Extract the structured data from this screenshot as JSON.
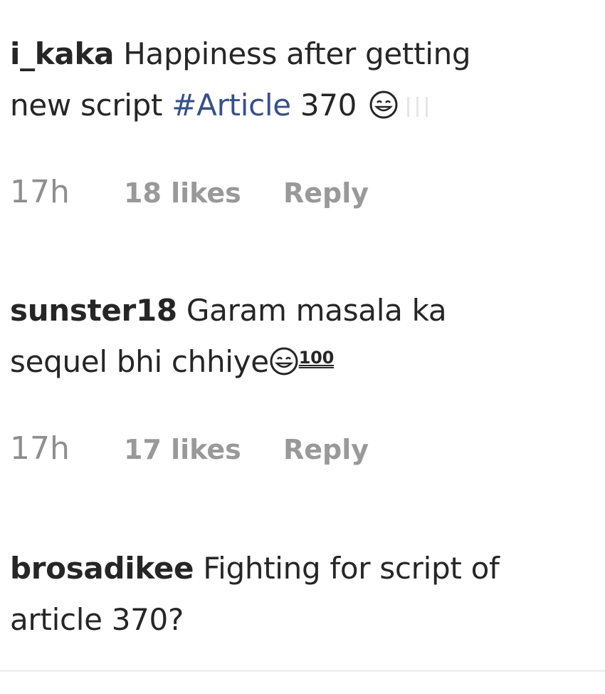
{
  "comments": [
    {
      "username": "i_kaka",
      "text_line1": "Happiness after getting",
      "text_line2": "new script ",
      "hashtag": "#Article",
      "text_after": " 370",
      "time": "17h",
      "likes": "18 likes",
      "reply": "Reply"
    },
    {
      "username": "sunster18",
      "text_line1": "Garam masala ka",
      "text_line2": "sequel bhi chhiye",
      "badge": "100",
      "time": "17h",
      "likes": "17 likes",
      "reply": "Reply"
    },
    {
      "username": "brosadikee",
      "text_line1": "Fighting for script of",
      "text_line2": "article 370?"
    }
  ]
}
